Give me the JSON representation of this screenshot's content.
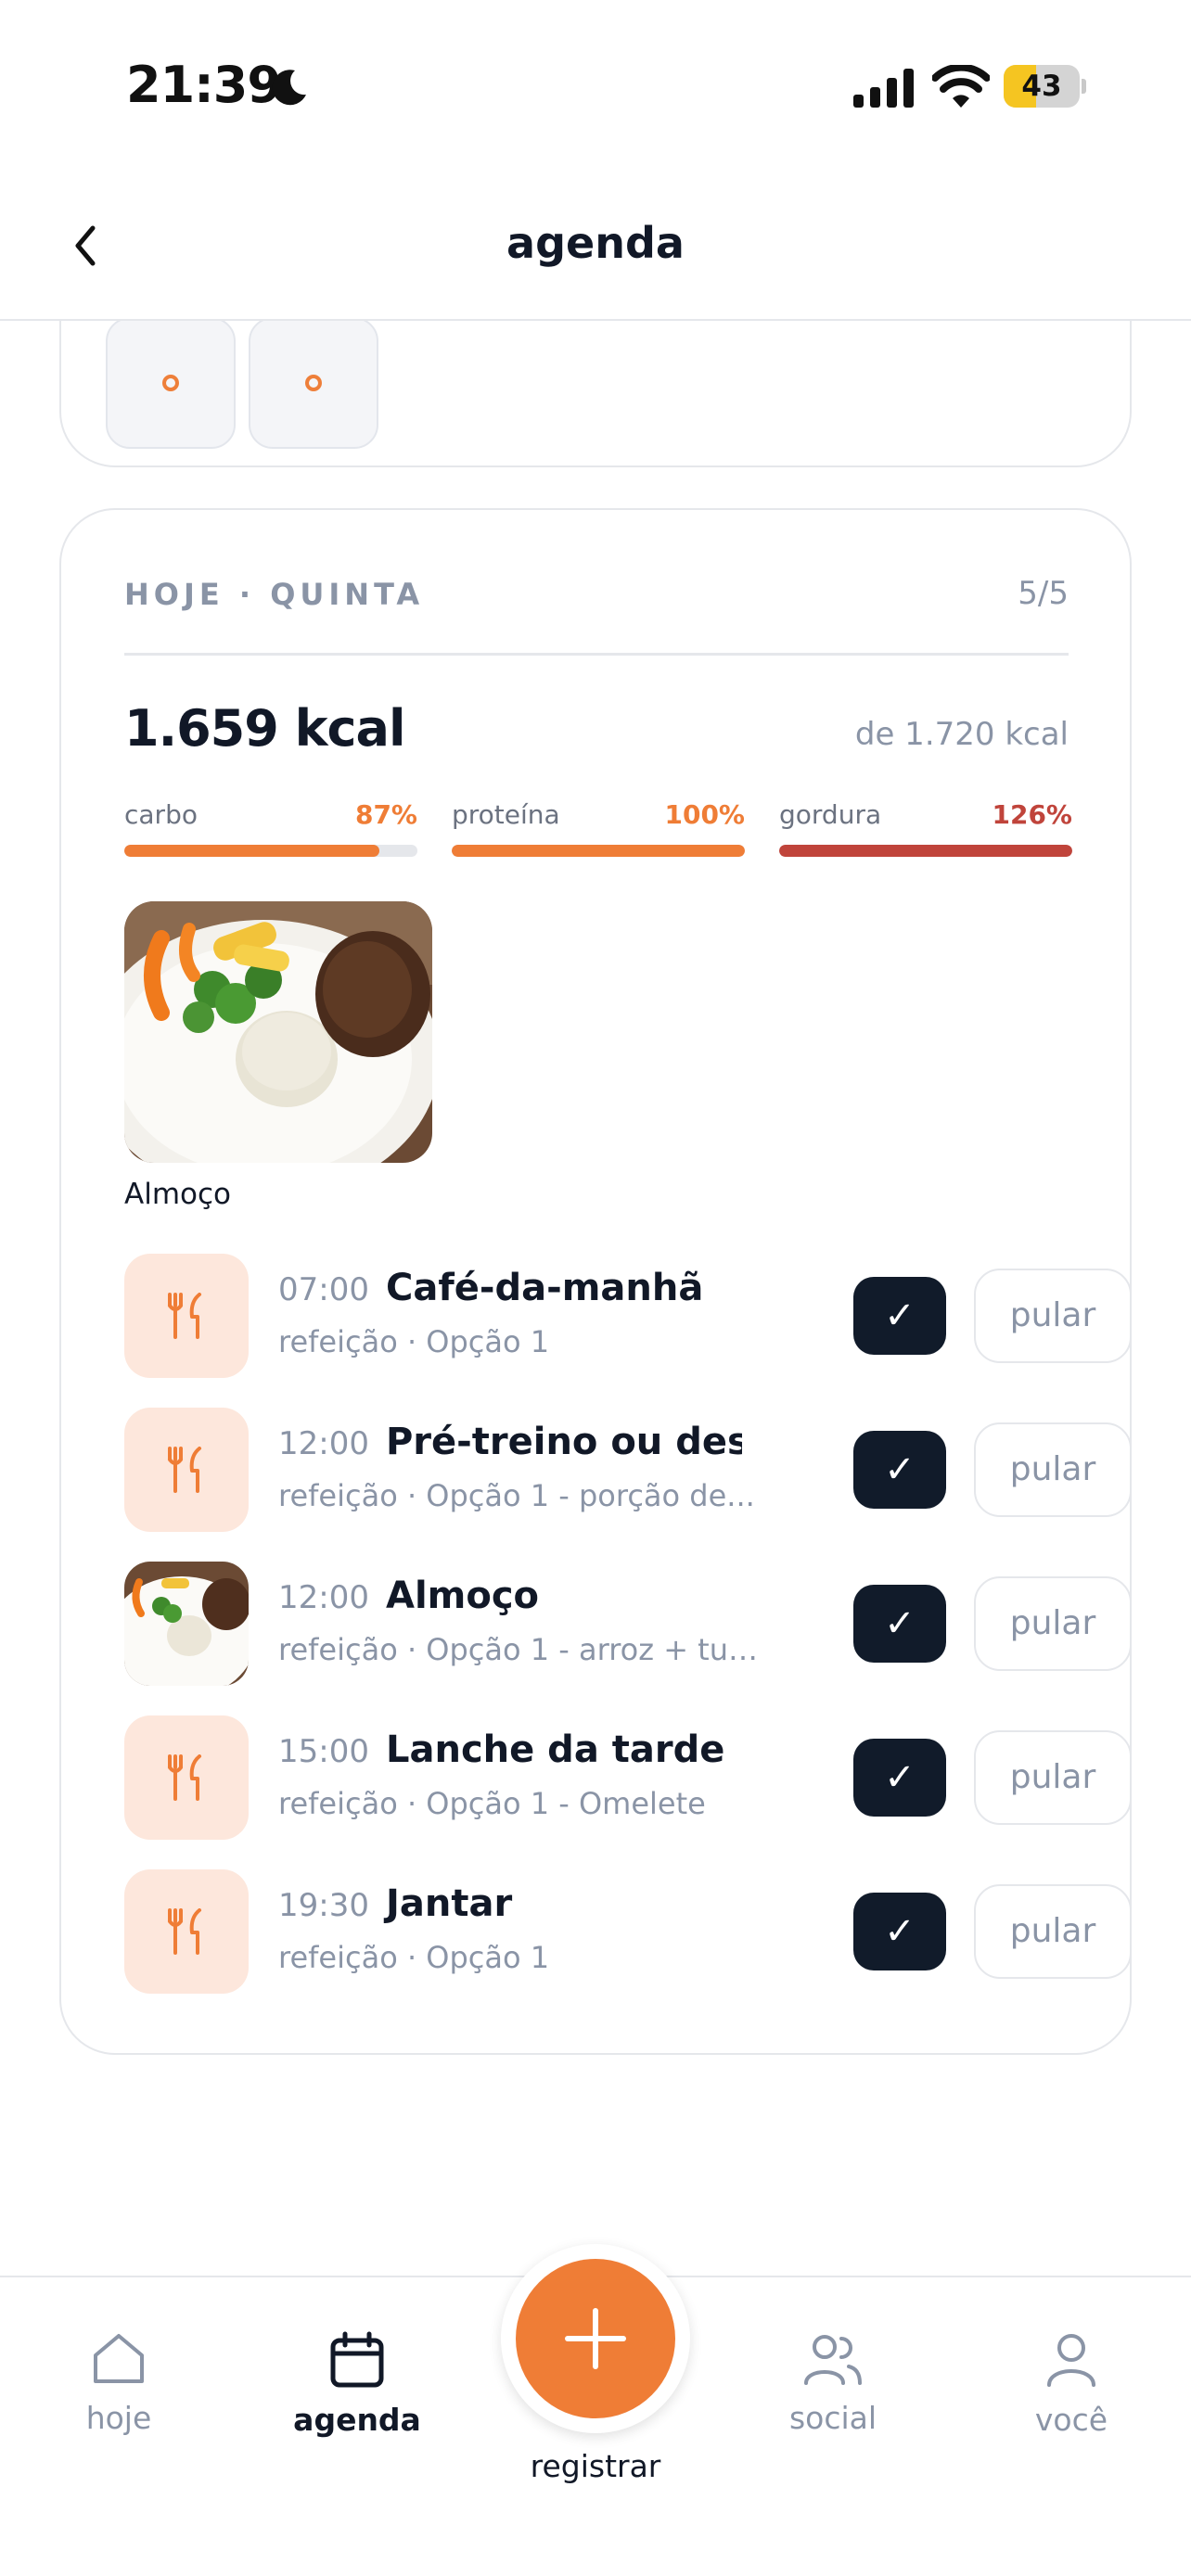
{
  "status_bar": {
    "time": "21:39",
    "battery": "43",
    "battery_level": 0.43
  },
  "header": {
    "title": "agenda"
  },
  "today": {
    "day_label": "HOJE · QUINTA",
    "count": "5/5",
    "kcal": "1.659 kcal",
    "kcal_goal": "de 1.720 kcal",
    "macros": [
      {
        "name": "carbo",
        "pct": "87%",
        "fraction": 0.87,
        "color": "#ef7d36"
      },
      {
        "name": "proteína",
        "pct": "100%",
        "fraction": 1.0,
        "color": "#ef7d36"
      },
      {
        "name": "gordura",
        "pct": "126%",
        "fraction": 1.0,
        "color": "#c0443b"
      }
    ],
    "photo_caption": "Almoço",
    "meals": [
      {
        "time": "07:00",
        "name": "Café-da-manhã",
        "detail": "refeição · Opção 1",
        "check": "✓",
        "skip": "pular",
        "has_photo": false
      },
      {
        "time": "12:00",
        "name": "Pré-treino ou desj...",
        "detail": "refeição · Opção 1 - porção de...",
        "check": "✓",
        "skip": "pular",
        "has_photo": false
      },
      {
        "time": "12:00",
        "name": "Almoço",
        "detail": "refeição · Opção 1 - arroz + tub...",
        "check": "✓",
        "skip": "pular",
        "has_photo": true
      },
      {
        "time": "15:00",
        "name": "Lanche da tarde",
        "detail": "refeição · Opção 1 - Omelete",
        "check": "✓",
        "skip": "pular",
        "has_photo": false
      },
      {
        "time": "19:30",
        "name": "Jantar",
        "detail": "refeição · Opção 1",
        "check": "✓",
        "skip": "pular",
        "has_photo": false
      }
    ]
  },
  "tabs": [
    {
      "label": "hoje",
      "icon": "home-icon"
    },
    {
      "label": "agenda",
      "icon": "calendar-icon",
      "active": true
    },
    {
      "label": "social",
      "icon": "users-icon"
    },
    {
      "label": "você",
      "icon": "user-icon"
    }
  ],
  "fab": {
    "label": "registrar",
    "icon": "plus-icon"
  },
  "colors": {
    "accent": "#ef7d36",
    "danger": "#c0443b",
    "dark": "#111b2a",
    "muted": "#8a94a6"
  }
}
